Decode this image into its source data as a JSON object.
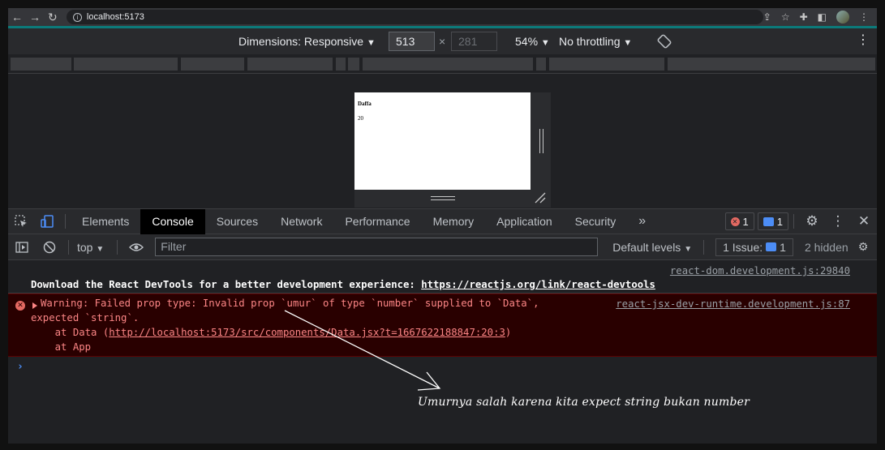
{
  "browser": {
    "url": "localhost:5173"
  },
  "device_toolbar": {
    "dimensions_label": "Dimensions: Responsive",
    "width_value": "513",
    "height_value": "281",
    "times": "×",
    "zoom": "54%",
    "throttling": "No throttling"
  },
  "page_preview": {
    "name": "Daffa",
    "age": "20"
  },
  "devtools_tabs": {
    "elements": "Elements",
    "console": "Console",
    "sources": "Sources",
    "network": "Network",
    "performance": "Performance",
    "memory": "Memory",
    "application": "Application",
    "security": "Security",
    "more": "»",
    "error_count": "1",
    "message_count": "1"
  },
  "console_toolbar": {
    "context": "top",
    "filter_placeholder": "Filter",
    "levels": "Default levels",
    "issues_label": "1 Issue:",
    "issues_count": "1",
    "hidden": "2 hidden"
  },
  "console": {
    "info_source": "react-dom.development.js:29840",
    "info_text": "Download the React DevTools for a better development experience: ",
    "info_link": "https://reactjs.org/link/react-devtools",
    "error_source": "react-jsx-dev-runtime.development.js:87",
    "error_line1": "Warning: Failed prop type: Invalid prop `umur` of type `number` supplied to `Data`,",
    "error_line2": "expected `string`.",
    "error_line3_prefix": "    at Data (",
    "error_line3_link": "http://localhost:5173/src/components/Data.jsx?t=1667622188847:20:3",
    "error_line3_suffix": ")",
    "error_line4": "    at App",
    "prompt": "›"
  },
  "annotation": {
    "text": "Umurnya salah karena kita expect string bukan number"
  }
}
